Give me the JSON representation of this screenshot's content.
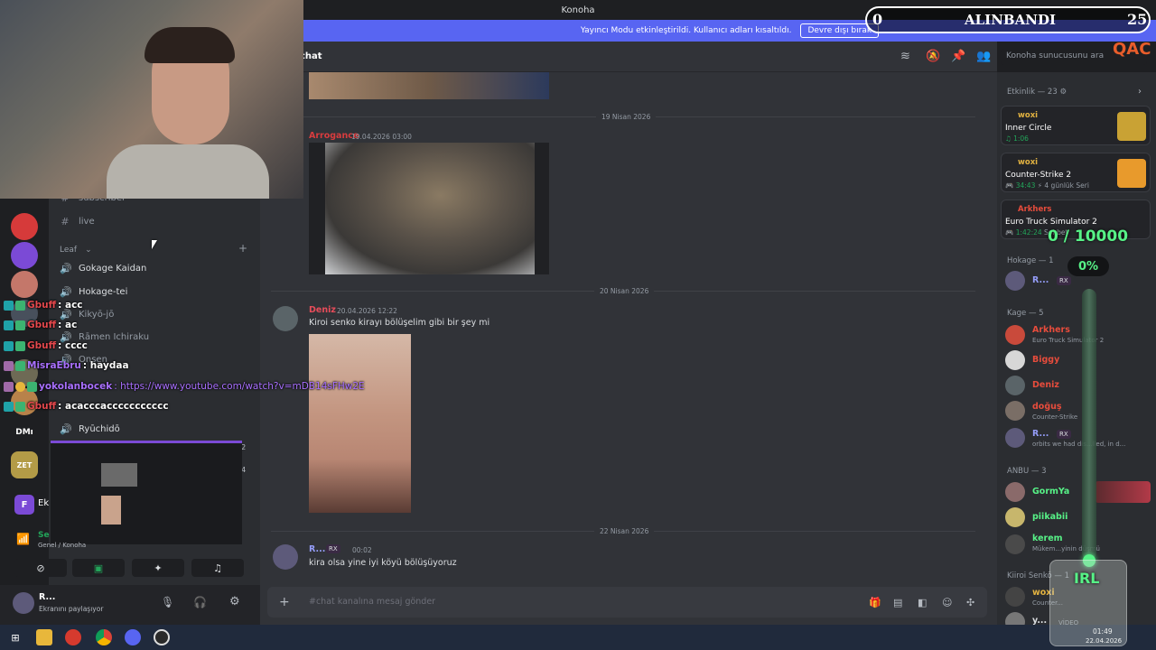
{
  "window": {
    "title": "Konoha"
  },
  "streamer_bar": {
    "text": "Yayıncı Modu etkinleştirildi. Kullanıcı adları kısaltıldı.",
    "button": "Devre dışı bırak"
  },
  "servers": [
    {
      "label": "",
      "color": "#d63a3a"
    },
    {
      "label": "",
      "color": "#7b4ad6"
    },
    {
      "label": "",
      "color": "#c4776a"
    },
    {
      "label": "",
      "color": "#48505c"
    },
    {
      "label": "",
      "color": "#6e6a55"
    },
    {
      "label": "",
      "color": "#b8824a"
    },
    {
      "label": "DMı",
      "color": "#2b2d31"
    },
    {
      "label": "ZET",
      "color": "#b39b47"
    }
  ],
  "channels": {
    "text": [
      {
        "name": "subscriber"
      },
      {
        "name": "live"
      }
    ],
    "category": "Leaf",
    "voice": [
      {
        "name": "Gokage Kaidan"
      },
      {
        "name": "Hokage-tei"
      },
      {
        "name": "Kikyō-jō"
      },
      {
        "name": "Rāmen Ichiraku"
      },
      {
        "name": "Onsen"
      },
      {
        "name": "Ryūchidō",
        "count_a": "00",
        "count_b": "04"
      }
    ],
    "extra_counts": {
      "a": "00",
      "b": "02"
    }
  },
  "activity_popup": {
    "label": "Ek"
  },
  "voice_status": {
    "title": "Se",
    "sub": "Genel / Konoha"
  },
  "user": {
    "name": "R...",
    "status": "Ekranını paylaşıyor"
  },
  "chat": {
    "channel_title": "chat",
    "search_placeholder": "Konoha sunucusunu ara",
    "input_placeholder": "#chat kanalına mesaj gönder",
    "dates": [
      "19 Nisan 2026",
      "20 Nisan 2026",
      "22 Nisan 2026"
    ],
    "messages": [
      {
        "author": "Arrogance",
        "time": "19.04.2026 03:00",
        "text": "",
        "author_color": "#d83c3e"
      },
      {
        "author": "Deniz",
        "time": "20.04.2026 12:22",
        "text_a": "Kiroi senko kirayı bölüşelim",
        "text_b": " gibi bir şey mi",
        "author_color": "#e74c5a"
      },
      {
        "author": "R...",
        "badge": "RX",
        "time": "00:02",
        "text": "kira olsa yine iyi köyü bölüşüyoruz",
        "author_color": "#949cf7"
      }
    ]
  },
  "members": {
    "activity_header": "Etkinlik — 23",
    "activities": [
      {
        "user": "woxi",
        "title": "Inner Circle",
        "meta": "1:06"
      },
      {
        "user": "woxi",
        "title": "Counter-Strike 2",
        "meta": "34:43",
        "meta2": "4 günlük Seri"
      },
      {
        "user": "Arkhers",
        "title": "Euro Truck Simulator 2",
        "meta": "1:42:24",
        "meta2": "Sohbet"
      }
    ],
    "groups": [
      {
        "title": "Hokage — 1",
        "members": [
          {
            "name": "R...",
            "badge": "RX",
            "color": "#949cf7"
          }
        ]
      },
      {
        "title": "Kage — 5",
        "members": [
          {
            "name": "Arkhers",
            "sub": "Euro Truck Simulator 2",
            "color": "#e74c3c"
          },
          {
            "name": "Biggy",
            "sub": "",
            "color": "#e74c3c"
          },
          {
            "name": "Deniz",
            "sub": "",
            "color": "#e74c3c"
          },
          {
            "name": "doğuş",
            "sub": "Counter-Strike",
            "color": "#e74c3c"
          },
          {
            "name": "R...",
            "badge": "RX",
            "sub": "orbits we had dis...lled, in d...",
            "color": "#949cf7"
          }
        ]
      },
      {
        "title": "ANBU — 3",
        "members": [
          {
            "name": "GormYa",
            "sub": "",
            "color": "#57f287"
          },
          {
            "name": "piikabii",
            "sub": "",
            "color": "#57f287"
          },
          {
            "name": "kerem",
            "sub": "Mükem...yinin düşmü",
            "color": "#57f287"
          }
        ]
      },
      {
        "title": "Kiiroi Senkö — 1",
        "members": [
          {
            "name": "woxi",
            "sub": "Counter...",
            "color": "#e3b341"
          },
          {
            "name": "y...",
            "sub": "VİDEO",
            "color": "#dbdee1"
          }
        ]
      }
    ]
  },
  "overlay": {
    "scoreboard": {
      "left": "0",
      "label": "ALINBANDI",
      "right": "25"
    },
    "goal": "0 / 10000",
    "percent": "0%",
    "irl_label": "IRL",
    "corner_text": "QAC",
    "chat_lines": [
      {
        "user": "Gbuff",
        "text": ": acc",
        "color": "#e5484d"
      },
      {
        "user": "Gbuff",
        "text": ": ac",
        "color": "#e5484d"
      },
      {
        "user": "Gbuff",
        "text": ": cccc",
        "color": "#e5484d"
      },
      {
        "user": "MisraEbru",
        "text": ": haydaa",
        "color": "#a970ff"
      },
      {
        "user": "yokolanbocek",
        "text": ": https://www.youtube.com/watch?v=mDB14sFHw2E",
        "color": "#a970ff"
      },
      {
        "user": "Gbuff",
        "text": ": acacccaccccccccccc",
        "color": "#e5484d"
      }
    ]
  },
  "taskbar": {
    "time": "01:49",
    "date": "22.04.2026"
  }
}
